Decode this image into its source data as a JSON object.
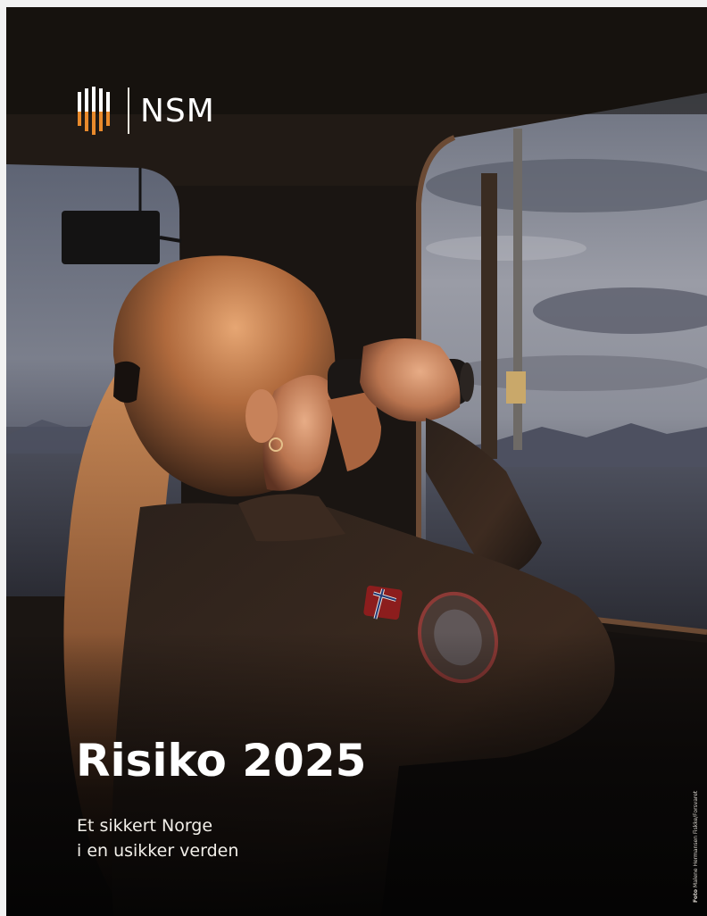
{
  "brand": {
    "name": "NSM",
    "mark_color": "#e98a2c",
    "icon": "nsm-bars-logo-icon"
  },
  "cover": {
    "title": "Risiko 2025",
    "subtitle_lines": [
      "Et sikkert Norge",
      "i en usikker verden"
    ]
  },
  "photo_credit": {
    "label": "Foto",
    "text": "Malene Hermansen Fiskke/Forsvaret"
  }
}
